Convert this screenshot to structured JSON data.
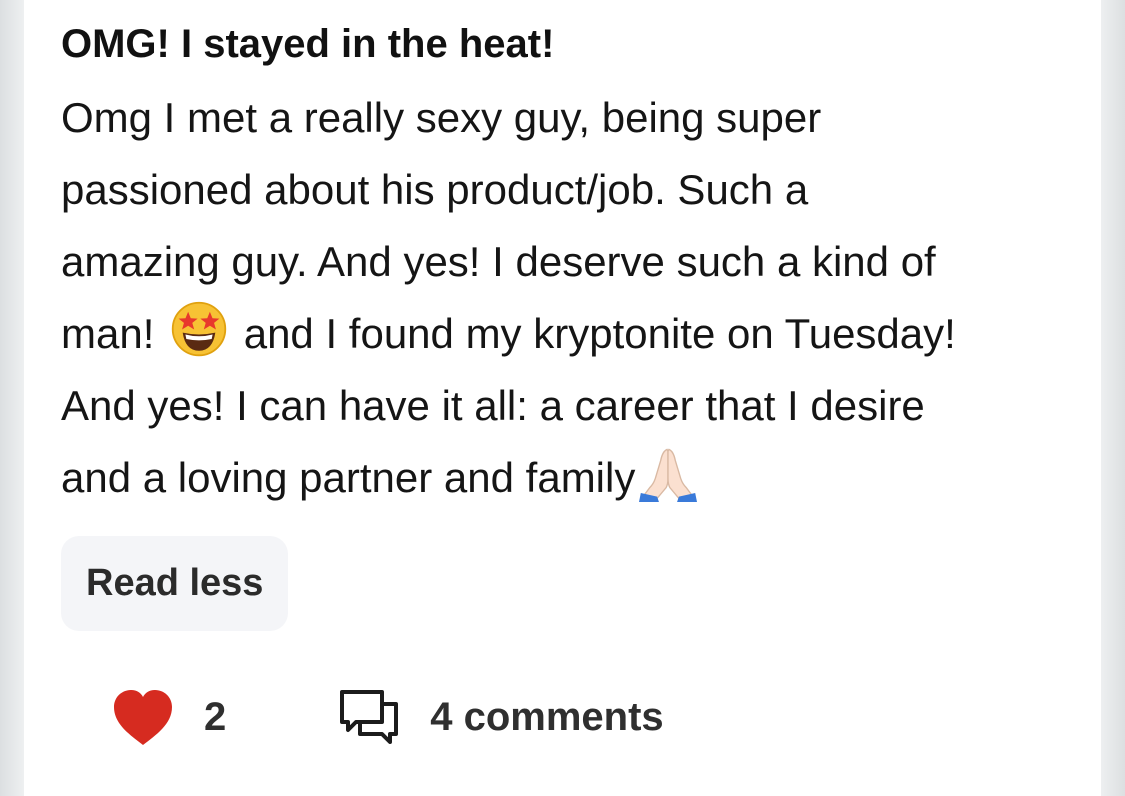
{
  "post": {
    "title": "OMG! I stayed in the heat!",
    "body_lines": [
      "Omg I met a really sexy guy, being super",
      "passioned about his product/job. Such a",
      "amazing guy. And yes! I deserve such a kind of",
      "man!",
      "and I found my kryptonite on Tuesday!",
      "And yes! I can have it all: a career that I desire",
      "and a loving partner and family"
    ],
    "emojis": [
      "star-struck-emoji",
      "folded-hands-emoji"
    ]
  },
  "read_less_label": "Read less",
  "actions": {
    "like_count": "2",
    "comments_label": "4 comments",
    "heart_color": "#d62b20"
  }
}
